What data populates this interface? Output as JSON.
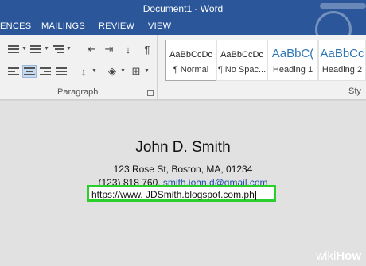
{
  "window": {
    "title": "Document1 - Word"
  },
  "ribbon_tabs": [
    "ENCES",
    "MAILINGS",
    "REVIEW",
    "VIEW"
  ],
  "ribbon": {
    "paragraph_group_label": "Paragraph",
    "styles_group_label": "Sty",
    "styles": [
      {
        "sample": "AaBbCcDc",
        "name": "¶ Normal",
        "selected": true
      },
      {
        "sample": "AaBbCcDc",
        "name": "¶ No Spac...",
        "selected": false
      },
      {
        "sample": "AaBbC(",
        "name": "Heading 1",
        "selected": false
      },
      {
        "sample": "AaBbCc",
        "name": "Heading 2",
        "selected": false
      }
    ]
  },
  "document": {
    "name": "John D. Smith",
    "address": "123 Rose St, Boston, MA, 01234",
    "phone": "(123) 818 760, ",
    "email": "smith.john.d@gmail.com",
    "url_input": "https://www. JDSmith.blogspot.com.ph"
  },
  "watermark": {
    "wiki": "wiki",
    "how": "How"
  },
  "colors": {
    "ribbon_blue": "#2b579a",
    "highlight_green": "#2bcf2b",
    "heading_blue": "#2e74b5",
    "link_blue": "#1f4ea8"
  }
}
